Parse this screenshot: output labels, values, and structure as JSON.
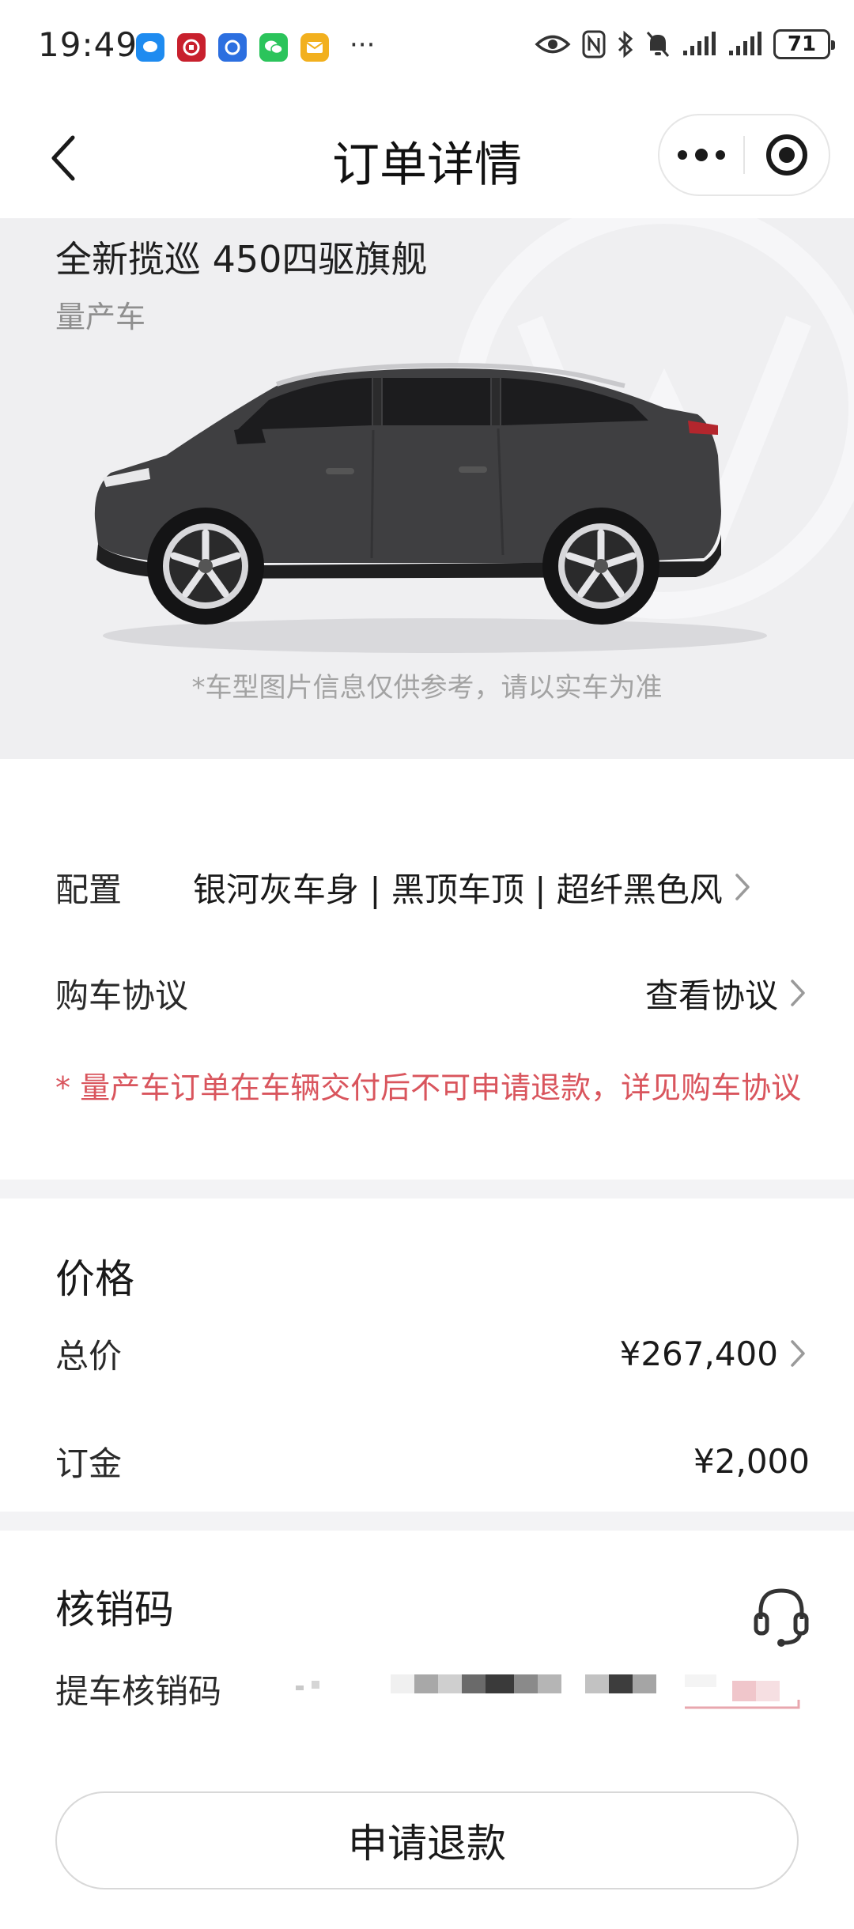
{
  "status_bar": {
    "time": "19:49",
    "battery": "71",
    "notifications": [
      {
        "name": "message-icon",
        "color": "#1e8bf0"
      },
      {
        "name": "bank-icon",
        "color": "#c8202d"
      },
      {
        "name": "app-icon",
        "color": "#2c6fe0"
      },
      {
        "name": "wechat-icon",
        "color": "#2bc45b"
      },
      {
        "name": "mail-icon",
        "color": "#f2b01e"
      }
    ],
    "more": "···"
  },
  "nav": {
    "title": "订单详情"
  },
  "hero": {
    "title": "全新揽巡 450四驱旗舰",
    "subtitle": "量产车",
    "disclaimer": "*车型图片信息仅供参考，请以实车为准",
    "car_color": "#3f3f41"
  },
  "order": {
    "config_label": "配置",
    "config_value": "银河灰车身 | 黑顶车顶 | 超纤黑色风",
    "agreement_label": "购车协议",
    "agreement_value": "查看协议",
    "refund_note": "* 量产车订单在车辆交付后不可申请退款，详见购车协议"
  },
  "price": {
    "section_title": "价格",
    "total_label": "总价",
    "total_value": "¥267,400",
    "deposit_label": "订金",
    "deposit_value": "¥2,000"
  },
  "verification": {
    "section_title": "核销码",
    "code_label": "提车核销码"
  },
  "actions": {
    "refund_button": "申请退款"
  },
  "colors": {
    "accent_red": "#d9555d",
    "hero_bg": "#efeff1",
    "divider": "#f3f3f5"
  }
}
